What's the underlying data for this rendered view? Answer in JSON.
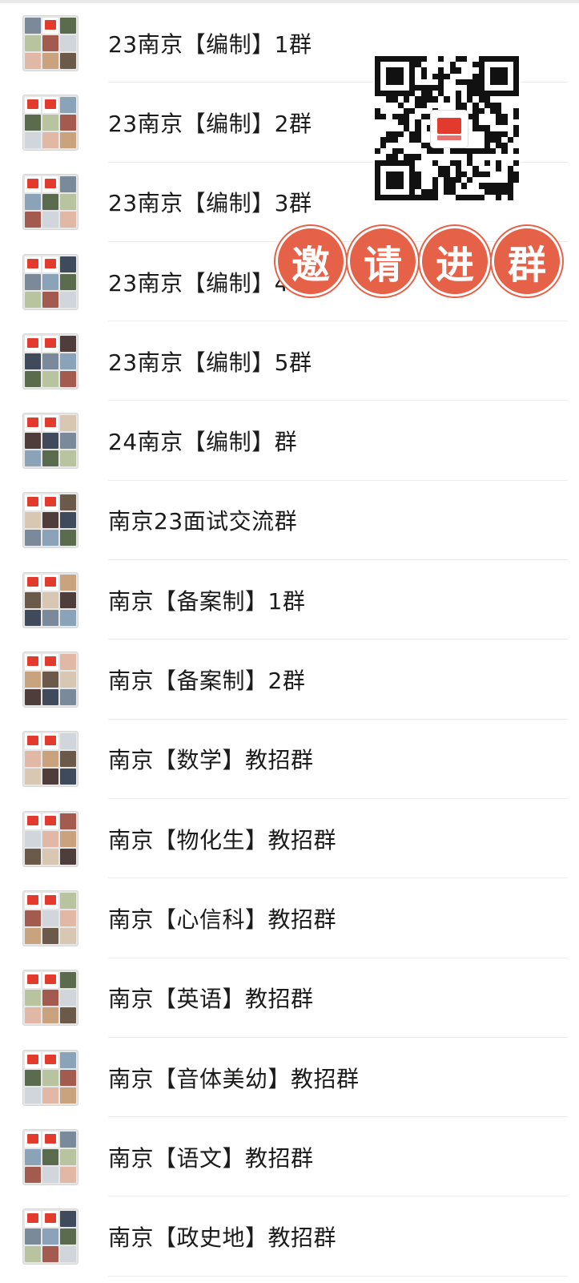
{
  "groups": [
    {
      "name": "23南京【编制】1群"
    },
    {
      "name": "23南京【编制】2群"
    },
    {
      "name": "23南京【编制】3群"
    },
    {
      "name": "23南京【编制】4群"
    },
    {
      "name": "23南京【编制】5群"
    },
    {
      "name": "24南京【编制】群"
    },
    {
      "name": "南京23面试交流群"
    },
    {
      "name": "南京【备案制】1群"
    },
    {
      "name": "南京【备案制】2群"
    },
    {
      "name": "南京【数学】教招群"
    },
    {
      "name": "南京【物化生】教招群"
    },
    {
      "name": "南京【心信科】教招群"
    },
    {
      "name": "南京【英语】教招群"
    },
    {
      "name": "南京【音体美幼】教招群"
    },
    {
      "name": "南京【语文】教招群"
    },
    {
      "name": "南京【政史地】教招群"
    }
  ],
  "overlay": {
    "invite_chars": [
      "邀",
      "请",
      "进",
      "群"
    ],
    "qr_icon": "qr-code-icon",
    "accent_color": "#e56249"
  }
}
